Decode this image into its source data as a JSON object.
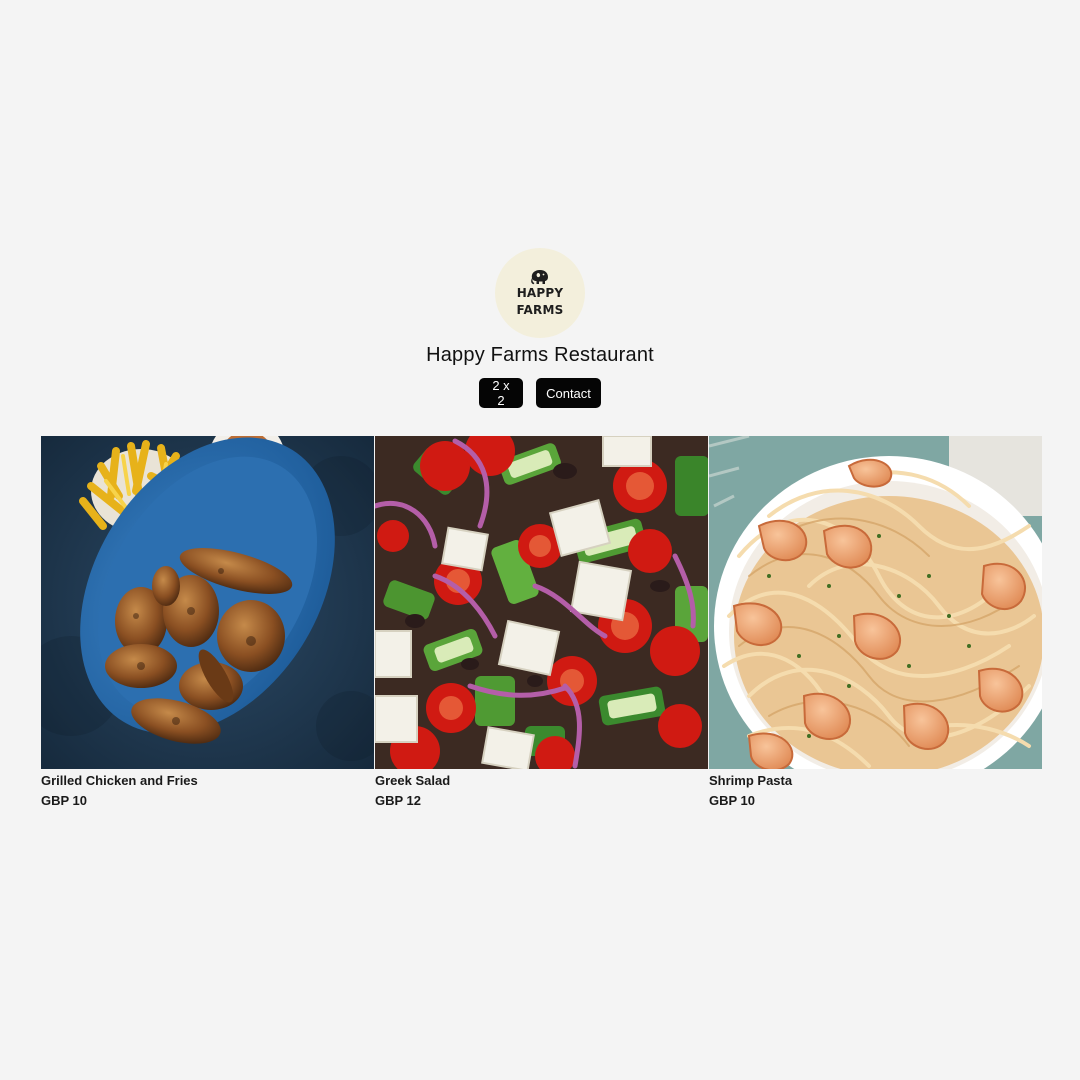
{
  "brand": {
    "logo_line1": "HAPPY",
    "logo_line2": "FARMS",
    "title": "Happy Farms Restaurant"
  },
  "actions": {
    "grid_label": "2 x 2",
    "contact_label": "Contact"
  },
  "colors": {
    "background": "#f4f4f4",
    "button_bg": "#050505",
    "button_text": "#ffffff",
    "logo_bg": "#f3efdc"
  },
  "products": [
    {
      "name": "Grilled Chicken and Fries",
      "price": "GBP 10",
      "image": "grilled-chicken-and-fries-photo"
    },
    {
      "name": "Greek Salad",
      "price": "GBP 12",
      "image": "greek-salad-photo"
    },
    {
      "name": "Shrimp Pasta",
      "price": "GBP 10",
      "image": "shrimp-pasta-photo"
    }
  ]
}
